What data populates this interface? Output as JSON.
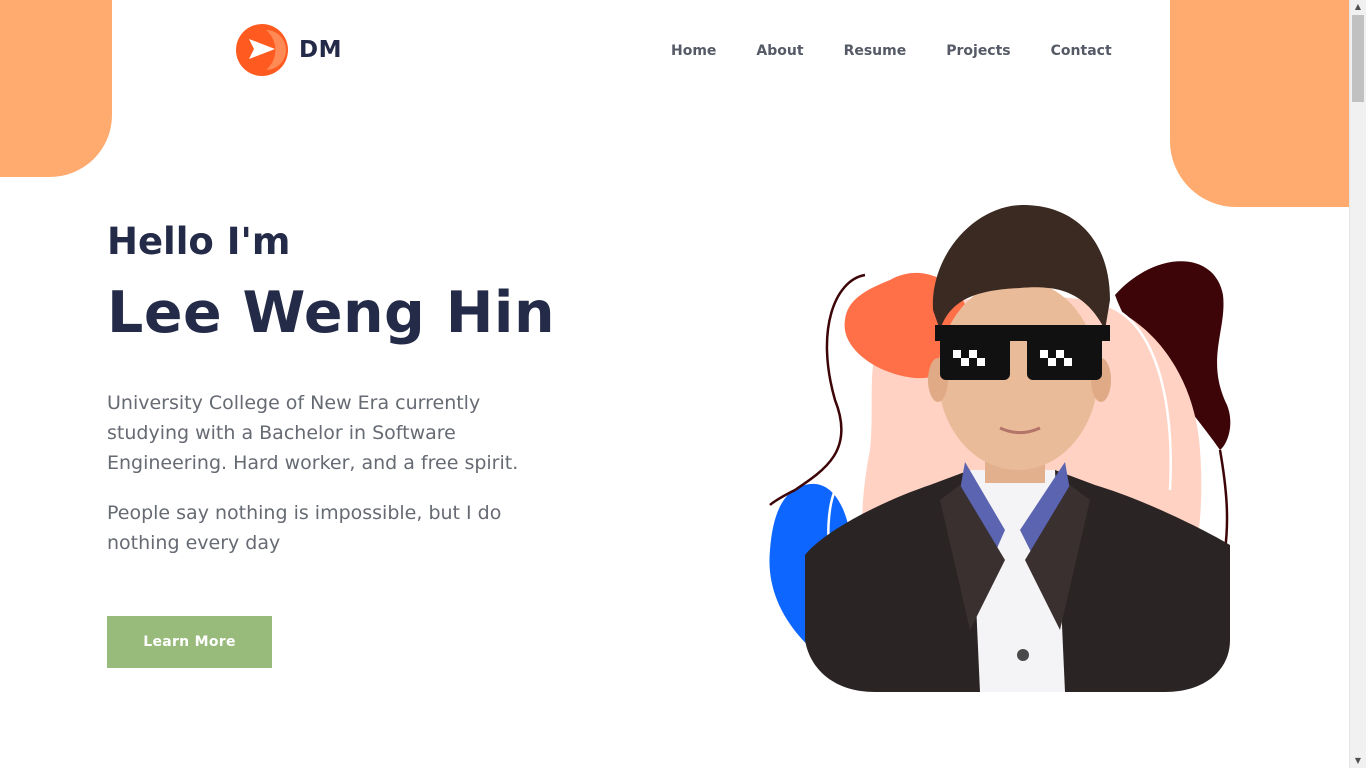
{
  "brand": {
    "logo_text": "DM",
    "accent_color": "#ff5a1f",
    "icon": "play-arrow-logo-icon"
  },
  "nav": {
    "items": [
      {
        "label": "Home"
      },
      {
        "label": "About"
      },
      {
        "label": "Resume"
      },
      {
        "label": "Projects"
      },
      {
        "label": "Contact"
      }
    ]
  },
  "hero": {
    "greeting": "Hello I'm",
    "name": "Lee Weng Hin",
    "description": "University College of New Era currently studying with a Bachelor in Software Engineering. Hard worker, and a free spirit.",
    "quote": "People say nothing is impossible, but I do nothing every day",
    "cta_label": "Learn More",
    "cta_color": "#98bb7c"
  },
  "theme": {
    "blob_color": "#ffaa6e",
    "heading_color": "#242b48"
  }
}
